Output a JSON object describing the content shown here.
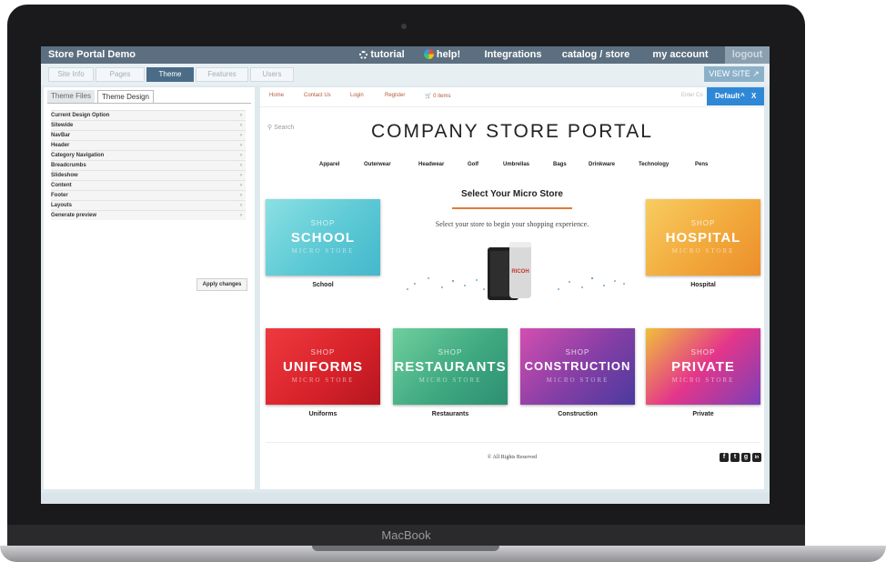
{
  "device": {
    "brand_label": "MacBook"
  },
  "app": {
    "title": "Store Portal Demo",
    "nav": [
      {
        "label": "tutorial",
        "icon": "gear-icon"
      },
      {
        "label": "help!",
        "icon": "pinwheel-icon"
      },
      {
        "label": "Integrations"
      },
      {
        "label": "catalog / store"
      },
      {
        "label": "my account"
      },
      {
        "label": "logout"
      }
    ]
  },
  "steps": [
    {
      "label": "Site Info",
      "active": false
    },
    {
      "label": "Pages",
      "active": false
    },
    {
      "label": "Theme",
      "active": true
    },
    {
      "label": "Features",
      "active": false
    },
    {
      "label": "Users",
      "active": false
    }
  ],
  "view_site": {
    "label": "VIEW SITE",
    "icon": "external-link-icon"
  },
  "left_panel": {
    "tabs": [
      {
        "label": "Theme Files"
      },
      {
        "label": "Theme Design"
      }
    ],
    "items": [
      "Current Design Option",
      "Sitewide",
      "NavBar",
      "Header",
      "Category Navigation",
      "Breadcrumbs",
      "Slideshow",
      "Content",
      "Footer",
      "Layouts",
      "Generate preview"
    ],
    "apply_label": "Apply changes"
  },
  "preview": {
    "top_links": [
      "Home",
      "Contact Us",
      "Login",
      "Register",
      "0 items"
    ],
    "enter_label": "Enter Co",
    "default_badge": {
      "label": "Default",
      "up": "^",
      "close": "X"
    },
    "search_label": "Search",
    "title": "COMPANY STORE PORTAL",
    "categories": [
      "Apparel",
      "Outerwear",
      "Headwear",
      "Golf",
      "Umbrellas",
      "Bags",
      "Drinkware",
      "Technology",
      "Pens"
    ],
    "micro_title": "Select Your Micro Store",
    "micro_sub": "Select your store to begin your shopping experience.",
    "product_label": "RICOH",
    "card_shop": "SHOP",
    "card_micro": "MICRO STORE",
    "cards": [
      {
        "name": "SCHOOL",
        "caption": "School"
      },
      {
        "name": "HOSPITAL",
        "caption": "Hospital"
      },
      {
        "name": "UNIFORMS",
        "caption": "Uniforms"
      },
      {
        "name": "RESTAURANTS",
        "caption": "Restaurants"
      },
      {
        "name": "CONSTRUCTION",
        "caption": "Construction"
      },
      {
        "name": "PRIVATE",
        "caption": "Private"
      }
    ],
    "copyright": "© All Rights Reserved",
    "social": [
      {
        "icon": "facebook-icon",
        "glyph": "f"
      },
      {
        "icon": "twitter-icon",
        "glyph": "t"
      },
      {
        "icon": "googleplus-icon",
        "glyph": "g"
      },
      {
        "icon": "linkedin-icon",
        "glyph": "in"
      }
    ]
  },
  "colors": {
    "topbar": "#5c6f80",
    "step_active": "#4b6c86",
    "accent_orange": "#e07b39",
    "default_badge": "#2f88d6",
    "school": "#5cc9d4",
    "hospital": "#f2a93b",
    "uniforms": "#d9232b",
    "restaurants": "#3fa981",
    "construction": "#8a3fa6",
    "private": "#e4368a"
  }
}
